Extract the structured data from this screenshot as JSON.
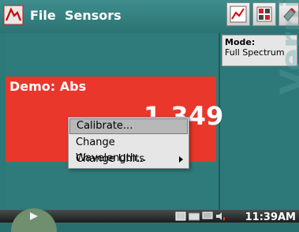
{
  "menubar": {
    "file_label": "File",
    "sensors_label": "Sensors",
    "tool_icons": [
      "graph-icon",
      "meter-icon",
      "tools-icon"
    ]
  },
  "mode": {
    "label": "Mode:",
    "value": "Full Spectrum"
  },
  "sensor_panel": {
    "title": "Demo: Abs",
    "value": "1.349"
  },
  "context_menu": {
    "items": [
      {
        "label": "Calibrate...",
        "has_submenu": false,
        "selected": true
      },
      {
        "label": "Change Wavelength...",
        "has_submenu": false,
        "selected": false
      },
      {
        "label": "Change Units",
        "has_submenu": true,
        "selected": false
      }
    ]
  },
  "watermark": "Vernier",
  "taskbar": {
    "clock": "11:39AM",
    "tray_icons": [
      "network-icon",
      "keyboard-icon",
      "display-icon",
      "volume-icon"
    ]
  },
  "colors": {
    "teal": "#2d7878",
    "red_panel": "#e9372b"
  }
}
